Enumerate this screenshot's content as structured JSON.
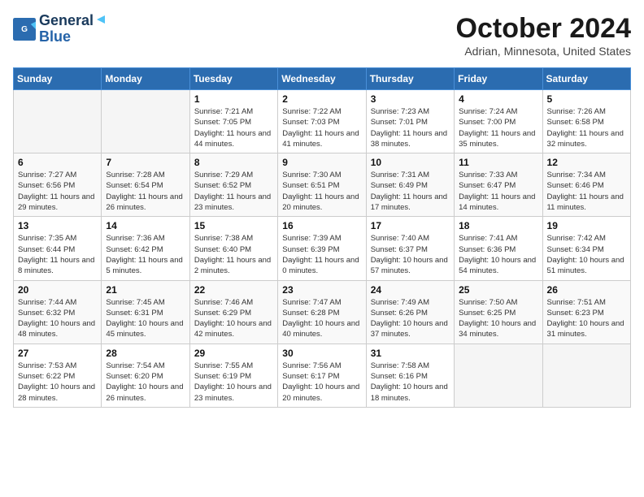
{
  "header": {
    "logo_line1": "General",
    "logo_line2": "Blue",
    "month_title": "October 2024",
    "location": "Adrian, Minnesota, United States"
  },
  "weekdays": [
    "Sunday",
    "Monday",
    "Tuesday",
    "Wednesday",
    "Thursday",
    "Friday",
    "Saturday"
  ],
  "weeks": [
    [
      {
        "day": "",
        "info": ""
      },
      {
        "day": "",
        "info": ""
      },
      {
        "day": "1",
        "info": "Sunrise: 7:21 AM\nSunset: 7:05 PM\nDaylight: 11 hours and 44 minutes."
      },
      {
        "day": "2",
        "info": "Sunrise: 7:22 AM\nSunset: 7:03 PM\nDaylight: 11 hours and 41 minutes."
      },
      {
        "day": "3",
        "info": "Sunrise: 7:23 AM\nSunset: 7:01 PM\nDaylight: 11 hours and 38 minutes."
      },
      {
        "day": "4",
        "info": "Sunrise: 7:24 AM\nSunset: 7:00 PM\nDaylight: 11 hours and 35 minutes."
      },
      {
        "day": "5",
        "info": "Sunrise: 7:26 AM\nSunset: 6:58 PM\nDaylight: 11 hours and 32 minutes."
      }
    ],
    [
      {
        "day": "6",
        "info": "Sunrise: 7:27 AM\nSunset: 6:56 PM\nDaylight: 11 hours and 29 minutes."
      },
      {
        "day": "7",
        "info": "Sunrise: 7:28 AM\nSunset: 6:54 PM\nDaylight: 11 hours and 26 minutes."
      },
      {
        "day": "8",
        "info": "Sunrise: 7:29 AM\nSunset: 6:52 PM\nDaylight: 11 hours and 23 minutes."
      },
      {
        "day": "9",
        "info": "Sunrise: 7:30 AM\nSunset: 6:51 PM\nDaylight: 11 hours and 20 minutes."
      },
      {
        "day": "10",
        "info": "Sunrise: 7:31 AM\nSunset: 6:49 PM\nDaylight: 11 hours and 17 minutes."
      },
      {
        "day": "11",
        "info": "Sunrise: 7:33 AM\nSunset: 6:47 PM\nDaylight: 11 hours and 14 minutes."
      },
      {
        "day": "12",
        "info": "Sunrise: 7:34 AM\nSunset: 6:46 PM\nDaylight: 11 hours and 11 minutes."
      }
    ],
    [
      {
        "day": "13",
        "info": "Sunrise: 7:35 AM\nSunset: 6:44 PM\nDaylight: 11 hours and 8 minutes."
      },
      {
        "day": "14",
        "info": "Sunrise: 7:36 AM\nSunset: 6:42 PM\nDaylight: 11 hours and 5 minutes."
      },
      {
        "day": "15",
        "info": "Sunrise: 7:38 AM\nSunset: 6:40 PM\nDaylight: 11 hours and 2 minutes."
      },
      {
        "day": "16",
        "info": "Sunrise: 7:39 AM\nSunset: 6:39 PM\nDaylight: 11 hours and 0 minutes."
      },
      {
        "day": "17",
        "info": "Sunrise: 7:40 AM\nSunset: 6:37 PM\nDaylight: 10 hours and 57 minutes."
      },
      {
        "day": "18",
        "info": "Sunrise: 7:41 AM\nSunset: 6:36 PM\nDaylight: 10 hours and 54 minutes."
      },
      {
        "day": "19",
        "info": "Sunrise: 7:42 AM\nSunset: 6:34 PM\nDaylight: 10 hours and 51 minutes."
      }
    ],
    [
      {
        "day": "20",
        "info": "Sunrise: 7:44 AM\nSunset: 6:32 PM\nDaylight: 10 hours and 48 minutes."
      },
      {
        "day": "21",
        "info": "Sunrise: 7:45 AM\nSunset: 6:31 PM\nDaylight: 10 hours and 45 minutes."
      },
      {
        "day": "22",
        "info": "Sunrise: 7:46 AM\nSunset: 6:29 PM\nDaylight: 10 hours and 42 minutes."
      },
      {
        "day": "23",
        "info": "Sunrise: 7:47 AM\nSunset: 6:28 PM\nDaylight: 10 hours and 40 minutes."
      },
      {
        "day": "24",
        "info": "Sunrise: 7:49 AM\nSunset: 6:26 PM\nDaylight: 10 hours and 37 minutes."
      },
      {
        "day": "25",
        "info": "Sunrise: 7:50 AM\nSunset: 6:25 PM\nDaylight: 10 hours and 34 minutes."
      },
      {
        "day": "26",
        "info": "Sunrise: 7:51 AM\nSunset: 6:23 PM\nDaylight: 10 hours and 31 minutes."
      }
    ],
    [
      {
        "day": "27",
        "info": "Sunrise: 7:53 AM\nSunset: 6:22 PM\nDaylight: 10 hours and 28 minutes."
      },
      {
        "day": "28",
        "info": "Sunrise: 7:54 AM\nSunset: 6:20 PM\nDaylight: 10 hours and 26 minutes."
      },
      {
        "day": "29",
        "info": "Sunrise: 7:55 AM\nSunset: 6:19 PM\nDaylight: 10 hours and 23 minutes."
      },
      {
        "day": "30",
        "info": "Sunrise: 7:56 AM\nSunset: 6:17 PM\nDaylight: 10 hours and 20 minutes."
      },
      {
        "day": "31",
        "info": "Sunrise: 7:58 AM\nSunset: 6:16 PM\nDaylight: 10 hours and 18 minutes."
      },
      {
        "day": "",
        "info": ""
      },
      {
        "day": "",
        "info": ""
      }
    ]
  ]
}
